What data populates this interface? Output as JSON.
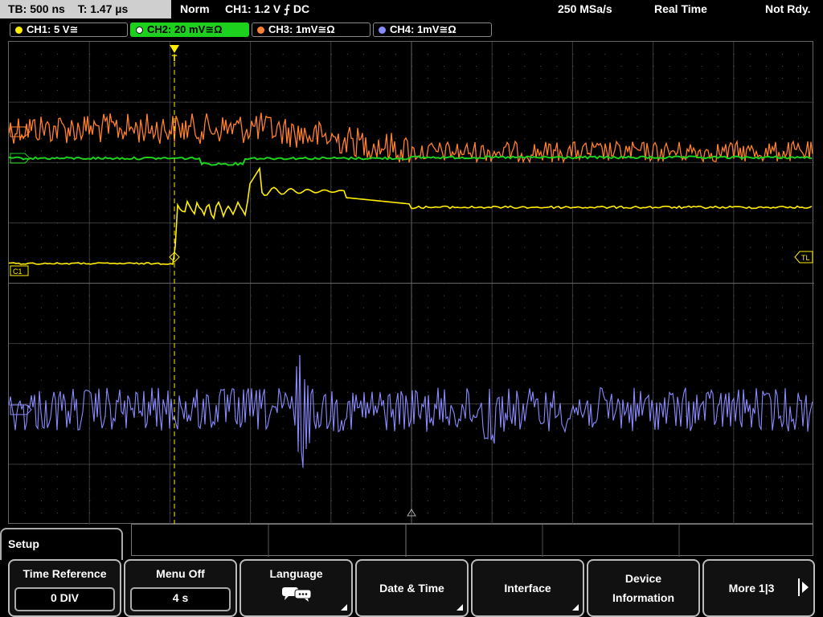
{
  "status": {
    "timebase": "TB: 500 ns",
    "trigger_time": "T: 1.47 µs",
    "trigger_mode": "Norm",
    "trigger_source": "CH1: 1.2 V ⨍ DC",
    "sample_rate": "250 MSa/s",
    "acq_mode": "Real Time",
    "state": "Not Rdy."
  },
  "channels": [
    {
      "label": "CH1: 5 V≅",
      "color": "#ffee00"
    },
    {
      "label": "CH2: 20 mV≅Ω",
      "color": "#1ed01e"
    },
    {
      "label": "CH3: 1mV≅Ω",
      "color": "#ff8030"
    },
    {
      "label": "CH4: 1mV≅Ω",
      "color": "#8a8aff"
    }
  ],
  "markers": {
    "c1": "C1",
    "tl": "TL",
    "trigger": "T"
  },
  "menu": {
    "title": "Setup",
    "softkeys": [
      {
        "label": "Time Reference",
        "value": "0 DIV"
      },
      {
        "label": "Menu Off",
        "value": "4 s"
      },
      {
        "label": "Language",
        "icon": "speech-bubbles-icon"
      },
      {
        "label": "Date & Time"
      },
      {
        "label": "Interface"
      },
      {
        "label": "Device Information"
      },
      {
        "label": "More 1|3"
      }
    ]
  }
}
